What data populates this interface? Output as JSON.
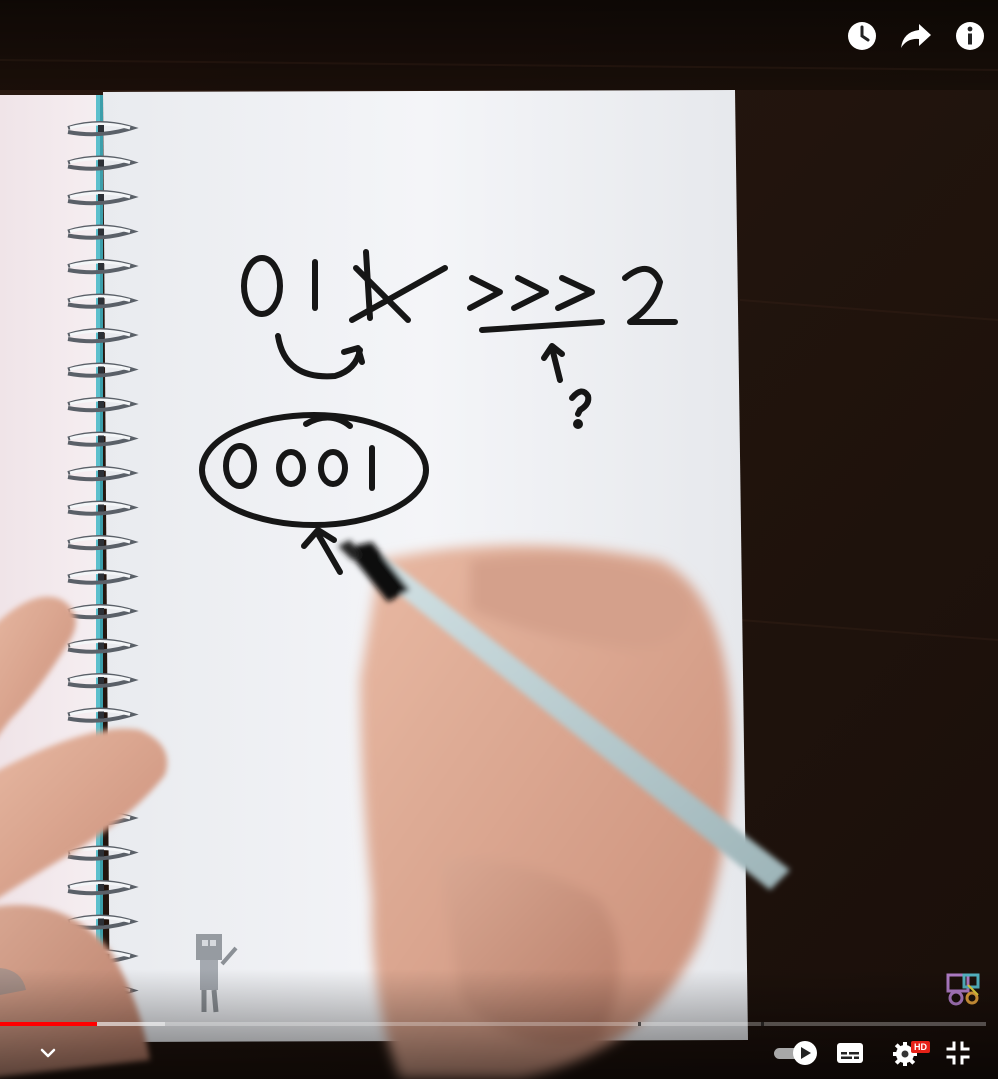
{
  "video": {
    "handwriting": {
      "line1_digits": "0 1",
      "crossed_digit": "1",
      "shift_operator": ">>>",
      "shift_amount": "2",
      "question_mark": "?",
      "circled_bits": "0001"
    }
  },
  "top_controls": {
    "watch_later_icon": "clock-icon",
    "share_icon": "share-arrow-icon",
    "info_icon": "info-icon"
  },
  "progress": {
    "played_fraction": 0.098,
    "buffered_fraction": 0.167,
    "chapter_breaks": [
      0.647,
      0.772
    ]
  },
  "bottom_controls": {
    "expand_icon": "chevron-down-icon",
    "autoplay_icon": "autoplay-toggle-icon",
    "captions_icon": "subtitles-icon",
    "settings_icon": "gear-icon",
    "quality_badge": "HD",
    "exit_fullscreen_icon": "exit-fullscreen-icon"
  },
  "colors": {
    "progress_played": "#ff0000",
    "hd_badge": "#e62117",
    "table": "#24150e",
    "paper": "#f1f2f5",
    "ink": "#161616",
    "spiral_accent": "#3fb6c6"
  }
}
